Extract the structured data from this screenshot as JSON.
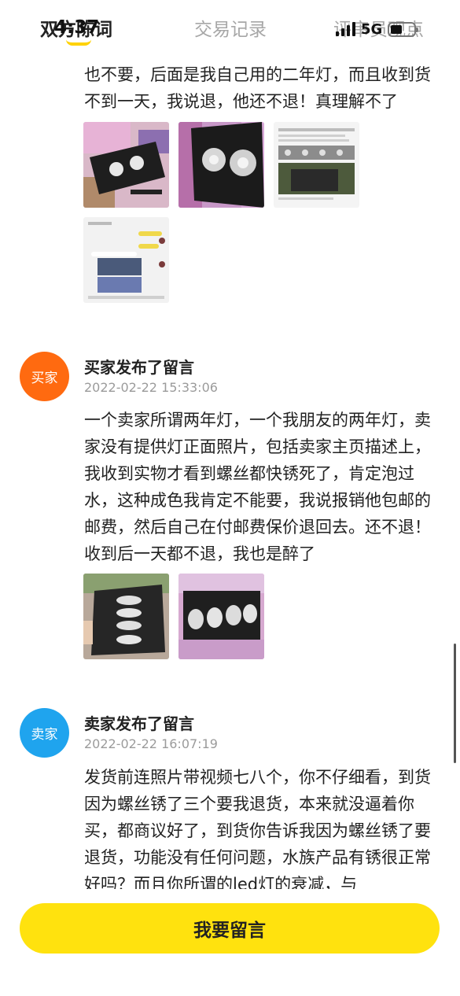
{
  "status_bar": {
    "time": "4:37",
    "network": "5G"
  },
  "tabs": [
    {
      "label": "双方陈词"
    },
    {
      "label": "交易记录"
    },
    {
      "label": "评审员观点"
    }
  ],
  "thread": {
    "intro_text": "也不要，后面是我自己用的二年灯，而且收到货不到一天，我说退，他还不退！真理解不了",
    "messages": [
      {
        "avatar_label": "买家",
        "title": "买家发布了留言",
        "time": "2022-02-22 15:33:06",
        "text": "一个卖家所谓两年灯，一个我朋友的两年灯，卖家没有提供灯正面照片，包括卖家主页描述上，我收到实物才看到螺丝都快锈死了，肯定泡过水，这种成色我肯定不能要，我说报销他包邮的邮费，然后自己在付邮费保价退回去。还不退！收到后一天都不退，我也是醉了",
        "avatar_color": "#ff6a10"
      },
      {
        "avatar_label": "卖家",
        "title": "卖家发布了留言",
        "time": "2022-02-22 16:07:19",
        "text": "发货前连照片带视频七八个，你不仔细看，到货因为螺丝锈了三个要我退货，本来就没逼着你买，都商议好了，到货你告诉我因为螺丝锈了要退货，功能没有任何问题，水族产品有锈很正常好吗？而且你所谓的led灯的衰减，与",
        "avatar_color": "#1fa4ee"
      }
    ]
  },
  "cta": {
    "label": "我要留言"
  },
  "colors": {
    "accent": "#ffe20e",
    "tab_indicator": "#ffd200"
  }
}
